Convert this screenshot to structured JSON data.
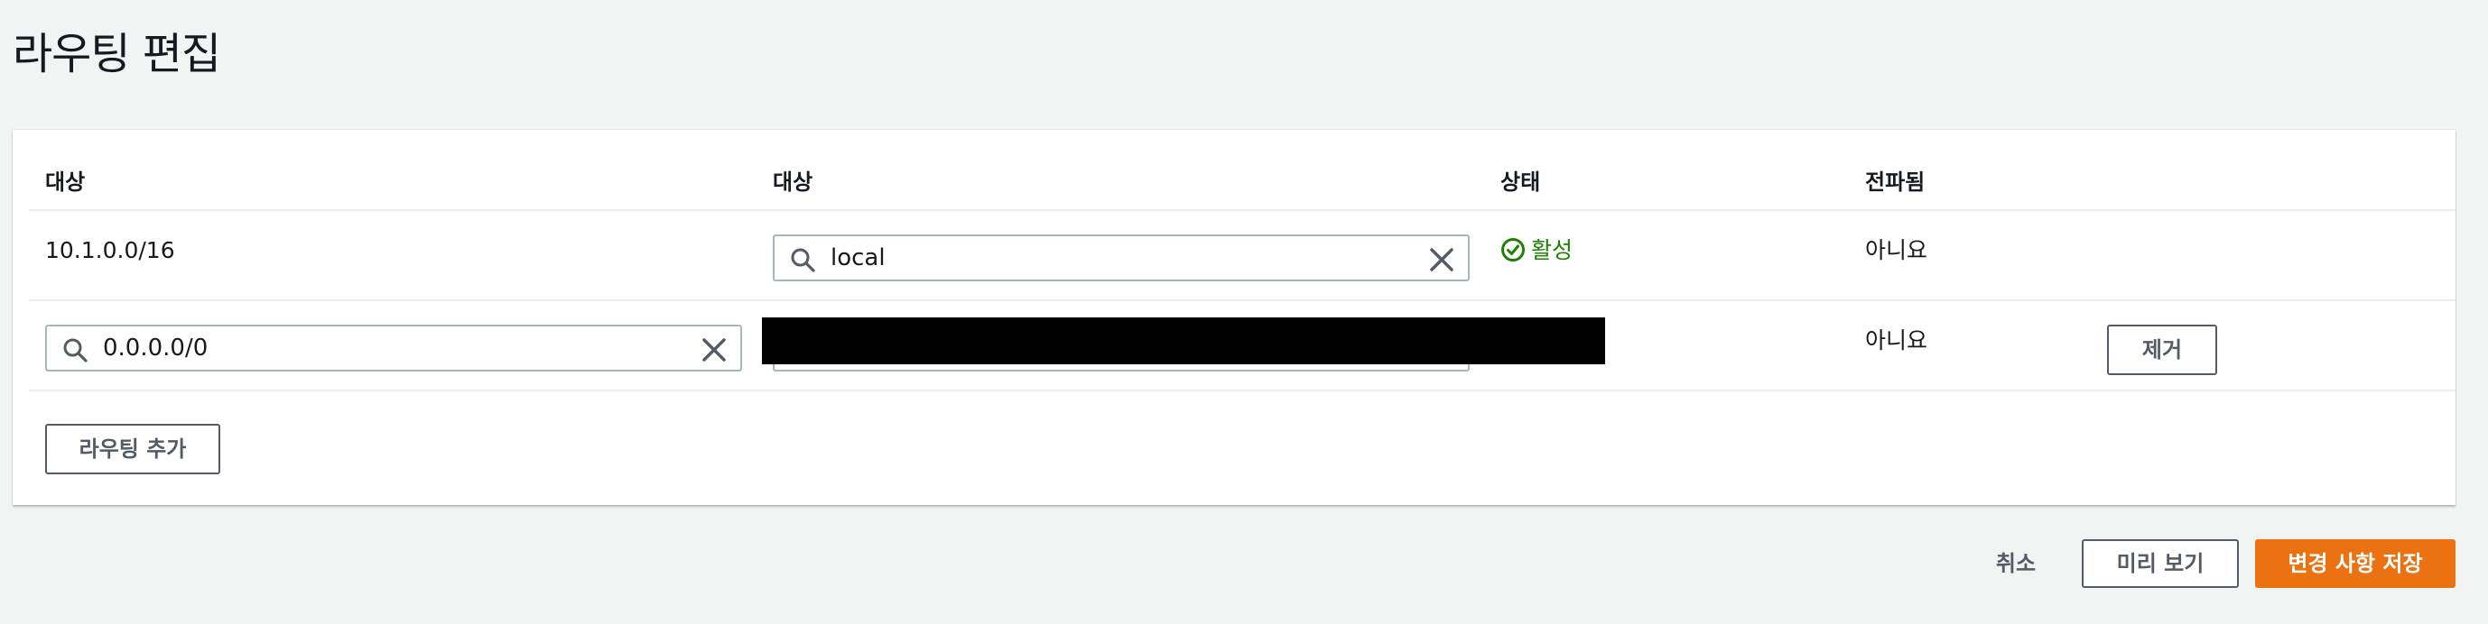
{
  "page": {
    "title": "라우팅 편집"
  },
  "table": {
    "headers": [
      "대상",
      "대상",
      "상태",
      "전파됨"
    ],
    "rows": [
      {
        "destination": "10.1.0.0/16",
        "target_value": "local",
        "status": "활성",
        "propagated": "아니요"
      },
      {
        "destination_value": "0.0.0.0/0",
        "propagated": "아니요",
        "remove_label": "제거"
      }
    ]
  },
  "add_route_label": "라우팅 추가",
  "footer": {
    "cancel_label": "취소",
    "preview_label": "미리 보기",
    "save_label": "변경 사항 저장"
  },
  "colors": {
    "accent": "#ec7211",
    "status_active": "#1d8102",
    "background": "#f2f3f3"
  },
  "icons": {
    "search": "search-icon",
    "clear": "close-icon",
    "status_ok": "check-circle-icon"
  }
}
